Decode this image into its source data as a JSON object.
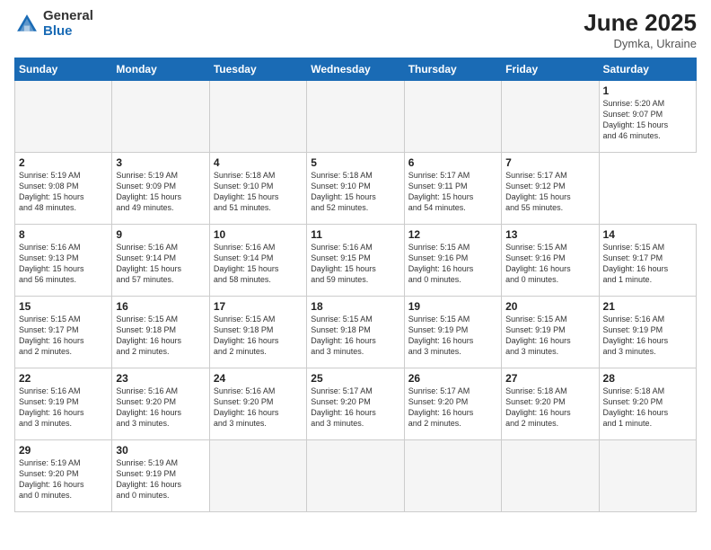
{
  "header": {
    "logo_general": "General",
    "logo_blue": "Blue",
    "title": "June 2025",
    "subtitle": "Dymka, Ukraine"
  },
  "calendar": {
    "days_of_week": [
      "Sunday",
      "Monday",
      "Tuesday",
      "Wednesday",
      "Thursday",
      "Friday",
      "Saturday"
    ],
    "weeks": [
      [
        {
          "day": "",
          "empty": true
        },
        {
          "day": "",
          "empty": true
        },
        {
          "day": "",
          "empty": true
        },
        {
          "day": "",
          "empty": true
        },
        {
          "day": "",
          "empty": true
        },
        {
          "day": "",
          "empty": true
        },
        {
          "day": "1",
          "info": "Sunrise: 5:20 AM\nSunset: 9:07 PM\nDaylight: 15 hours\nand 46 minutes."
        }
      ],
      [
        {
          "day": "2",
          "info": "Sunrise: 5:19 AM\nSunset: 9:08 PM\nDaylight: 15 hours\nand 48 minutes."
        },
        {
          "day": "3",
          "info": "Sunrise: 5:19 AM\nSunset: 9:09 PM\nDaylight: 15 hours\nand 49 minutes."
        },
        {
          "day": "4",
          "info": "Sunrise: 5:18 AM\nSunset: 9:10 PM\nDaylight: 15 hours\nand 51 minutes."
        },
        {
          "day": "5",
          "info": "Sunrise: 5:18 AM\nSunset: 9:10 PM\nDaylight: 15 hours\nand 52 minutes."
        },
        {
          "day": "6",
          "info": "Sunrise: 5:17 AM\nSunset: 9:11 PM\nDaylight: 15 hours\nand 54 minutes."
        },
        {
          "day": "7",
          "info": "Sunrise: 5:17 AM\nSunset: 9:12 PM\nDaylight: 15 hours\nand 55 minutes."
        }
      ],
      [
        {
          "day": "8",
          "info": "Sunrise: 5:16 AM\nSunset: 9:13 PM\nDaylight: 15 hours\nand 56 minutes."
        },
        {
          "day": "9",
          "info": "Sunrise: 5:16 AM\nSunset: 9:14 PM\nDaylight: 15 hours\nand 57 minutes."
        },
        {
          "day": "10",
          "info": "Sunrise: 5:16 AM\nSunset: 9:14 PM\nDaylight: 15 hours\nand 58 minutes."
        },
        {
          "day": "11",
          "info": "Sunrise: 5:16 AM\nSunset: 9:15 PM\nDaylight: 15 hours\nand 59 minutes."
        },
        {
          "day": "12",
          "info": "Sunrise: 5:15 AM\nSunset: 9:16 PM\nDaylight: 16 hours\nand 0 minutes."
        },
        {
          "day": "13",
          "info": "Sunrise: 5:15 AM\nSunset: 9:16 PM\nDaylight: 16 hours\nand 0 minutes."
        },
        {
          "day": "14",
          "info": "Sunrise: 5:15 AM\nSunset: 9:17 PM\nDaylight: 16 hours\nand 1 minute."
        }
      ],
      [
        {
          "day": "15",
          "info": "Sunrise: 5:15 AM\nSunset: 9:17 PM\nDaylight: 16 hours\nand 2 minutes."
        },
        {
          "day": "16",
          "info": "Sunrise: 5:15 AM\nSunset: 9:18 PM\nDaylight: 16 hours\nand 2 minutes."
        },
        {
          "day": "17",
          "info": "Sunrise: 5:15 AM\nSunset: 9:18 PM\nDaylight: 16 hours\nand 2 minutes."
        },
        {
          "day": "18",
          "info": "Sunrise: 5:15 AM\nSunset: 9:18 PM\nDaylight: 16 hours\nand 3 minutes."
        },
        {
          "day": "19",
          "info": "Sunrise: 5:15 AM\nSunset: 9:19 PM\nDaylight: 16 hours\nand 3 minutes."
        },
        {
          "day": "20",
          "info": "Sunrise: 5:15 AM\nSunset: 9:19 PM\nDaylight: 16 hours\nand 3 minutes."
        },
        {
          "day": "21",
          "info": "Sunrise: 5:16 AM\nSunset: 9:19 PM\nDaylight: 16 hours\nand 3 minutes."
        }
      ],
      [
        {
          "day": "22",
          "info": "Sunrise: 5:16 AM\nSunset: 9:19 PM\nDaylight: 16 hours\nand 3 minutes."
        },
        {
          "day": "23",
          "info": "Sunrise: 5:16 AM\nSunset: 9:20 PM\nDaylight: 16 hours\nand 3 minutes."
        },
        {
          "day": "24",
          "info": "Sunrise: 5:16 AM\nSunset: 9:20 PM\nDaylight: 16 hours\nand 3 minutes."
        },
        {
          "day": "25",
          "info": "Sunrise: 5:17 AM\nSunset: 9:20 PM\nDaylight: 16 hours\nand 3 minutes."
        },
        {
          "day": "26",
          "info": "Sunrise: 5:17 AM\nSunset: 9:20 PM\nDaylight: 16 hours\nand 2 minutes."
        },
        {
          "day": "27",
          "info": "Sunrise: 5:18 AM\nSunset: 9:20 PM\nDaylight: 16 hours\nand 2 minutes."
        },
        {
          "day": "28",
          "info": "Sunrise: 5:18 AM\nSunset: 9:20 PM\nDaylight: 16 hours\nand 1 minute."
        }
      ],
      [
        {
          "day": "29",
          "info": "Sunrise: 5:19 AM\nSunset: 9:20 PM\nDaylight: 16 hours\nand 0 minutes."
        },
        {
          "day": "30",
          "info": "Sunrise: 5:19 AM\nSunset: 9:19 PM\nDaylight: 16 hours\nand 0 minutes."
        },
        {
          "day": "",
          "empty": true
        },
        {
          "day": "",
          "empty": true
        },
        {
          "day": "",
          "empty": true
        },
        {
          "day": "",
          "empty": true
        },
        {
          "day": "",
          "empty": true
        }
      ]
    ]
  }
}
